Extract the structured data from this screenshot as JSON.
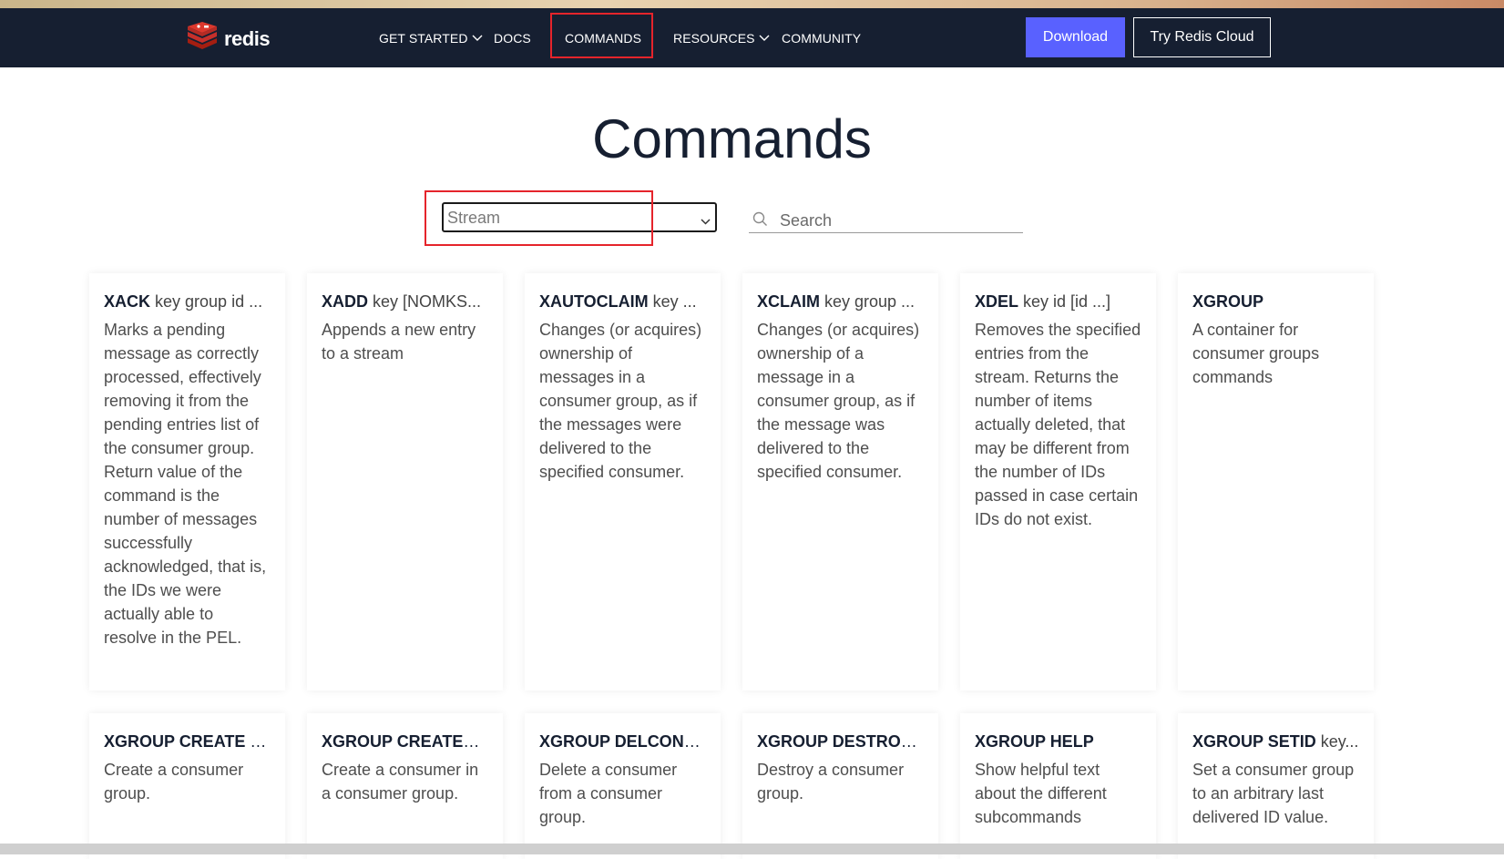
{
  "brand": {
    "name": "redis"
  },
  "nav": {
    "items": [
      {
        "label": "GET STARTED",
        "has_dropdown": true
      },
      {
        "label": "DOCS",
        "has_dropdown": false
      },
      {
        "label": "COMMANDS",
        "has_dropdown": false,
        "active": true
      },
      {
        "label": "RESOURCES",
        "has_dropdown": true
      },
      {
        "label": "COMMUNITY",
        "has_dropdown": false
      }
    ],
    "download_label": "Download",
    "cloud_label": "Try Redis Cloud"
  },
  "page": {
    "title": "Commands"
  },
  "filter": {
    "selected": "Stream"
  },
  "search": {
    "placeholder": "Search",
    "value": ""
  },
  "colors": {
    "nav_bg": "#161f31",
    "accent": "#5961ff",
    "highlight": "#e5242b"
  },
  "icons": {
    "logo": "redis-logo-icon",
    "search": "search-icon",
    "chevron": "chevron-down-icon"
  },
  "cards": [
    {
      "name": "XACK",
      "args": " key group id ...",
      "desc": "Marks a pending message as correctly processed, effectively removing it from the pending entries list of the consumer group. Return value of the command is the number of messages successfully acknowledged, that is, the IDs we were actually able to resolve in the PEL."
    },
    {
      "name": "XADD",
      "args": " key [NOMKS...",
      "desc": "Appends a new entry to a stream"
    },
    {
      "name": "XAUTOCLAIM",
      "args": " key ...",
      "desc": "Changes (or acquires) ownership of messages in a consumer group, as if the messages were delivered to the specified consumer."
    },
    {
      "name": "XCLAIM",
      "args": " key group ...",
      "desc": "Changes (or acquires) ownership of a message in a consumer group, as if the message was delivered to the specified consumer."
    },
    {
      "name": "XDEL",
      "args": " key id [id ...]",
      "desc": "Removes the specified entries from the stream. Returns the number of items actually deleted, that may be different from the number of IDs passed in case certain IDs do not exist."
    },
    {
      "name": "XGROUP",
      "args": "",
      "desc": "A container for consumer groups commands"
    },
    {
      "name": "XGROUP CREATE",
      "args": " k...",
      "desc": "Create a consumer group."
    },
    {
      "name": "XGROUP CREATEC...",
      "args": "",
      "desc": "Create a consumer in a consumer group."
    },
    {
      "name": "XGROUP DELCONS...",
      "args": "",
      "desc": "Delete a consumer from a consumer group."
    },
    {
      "name": "XGROUP DESTROY",
      "args": " ...",
      "desc": "Destroy a consumer group."
    },
    {
      "name": "XGROUP HELP",
      "args": "",
      "desc": "Show helpful text about the different subcommands"
    },
    {
      "name": "XGROUP SETID",
      "args": " key...",
      "desc": "Set a consumer group to an arbitrary last delivered ID value."
    }
  ]
}
